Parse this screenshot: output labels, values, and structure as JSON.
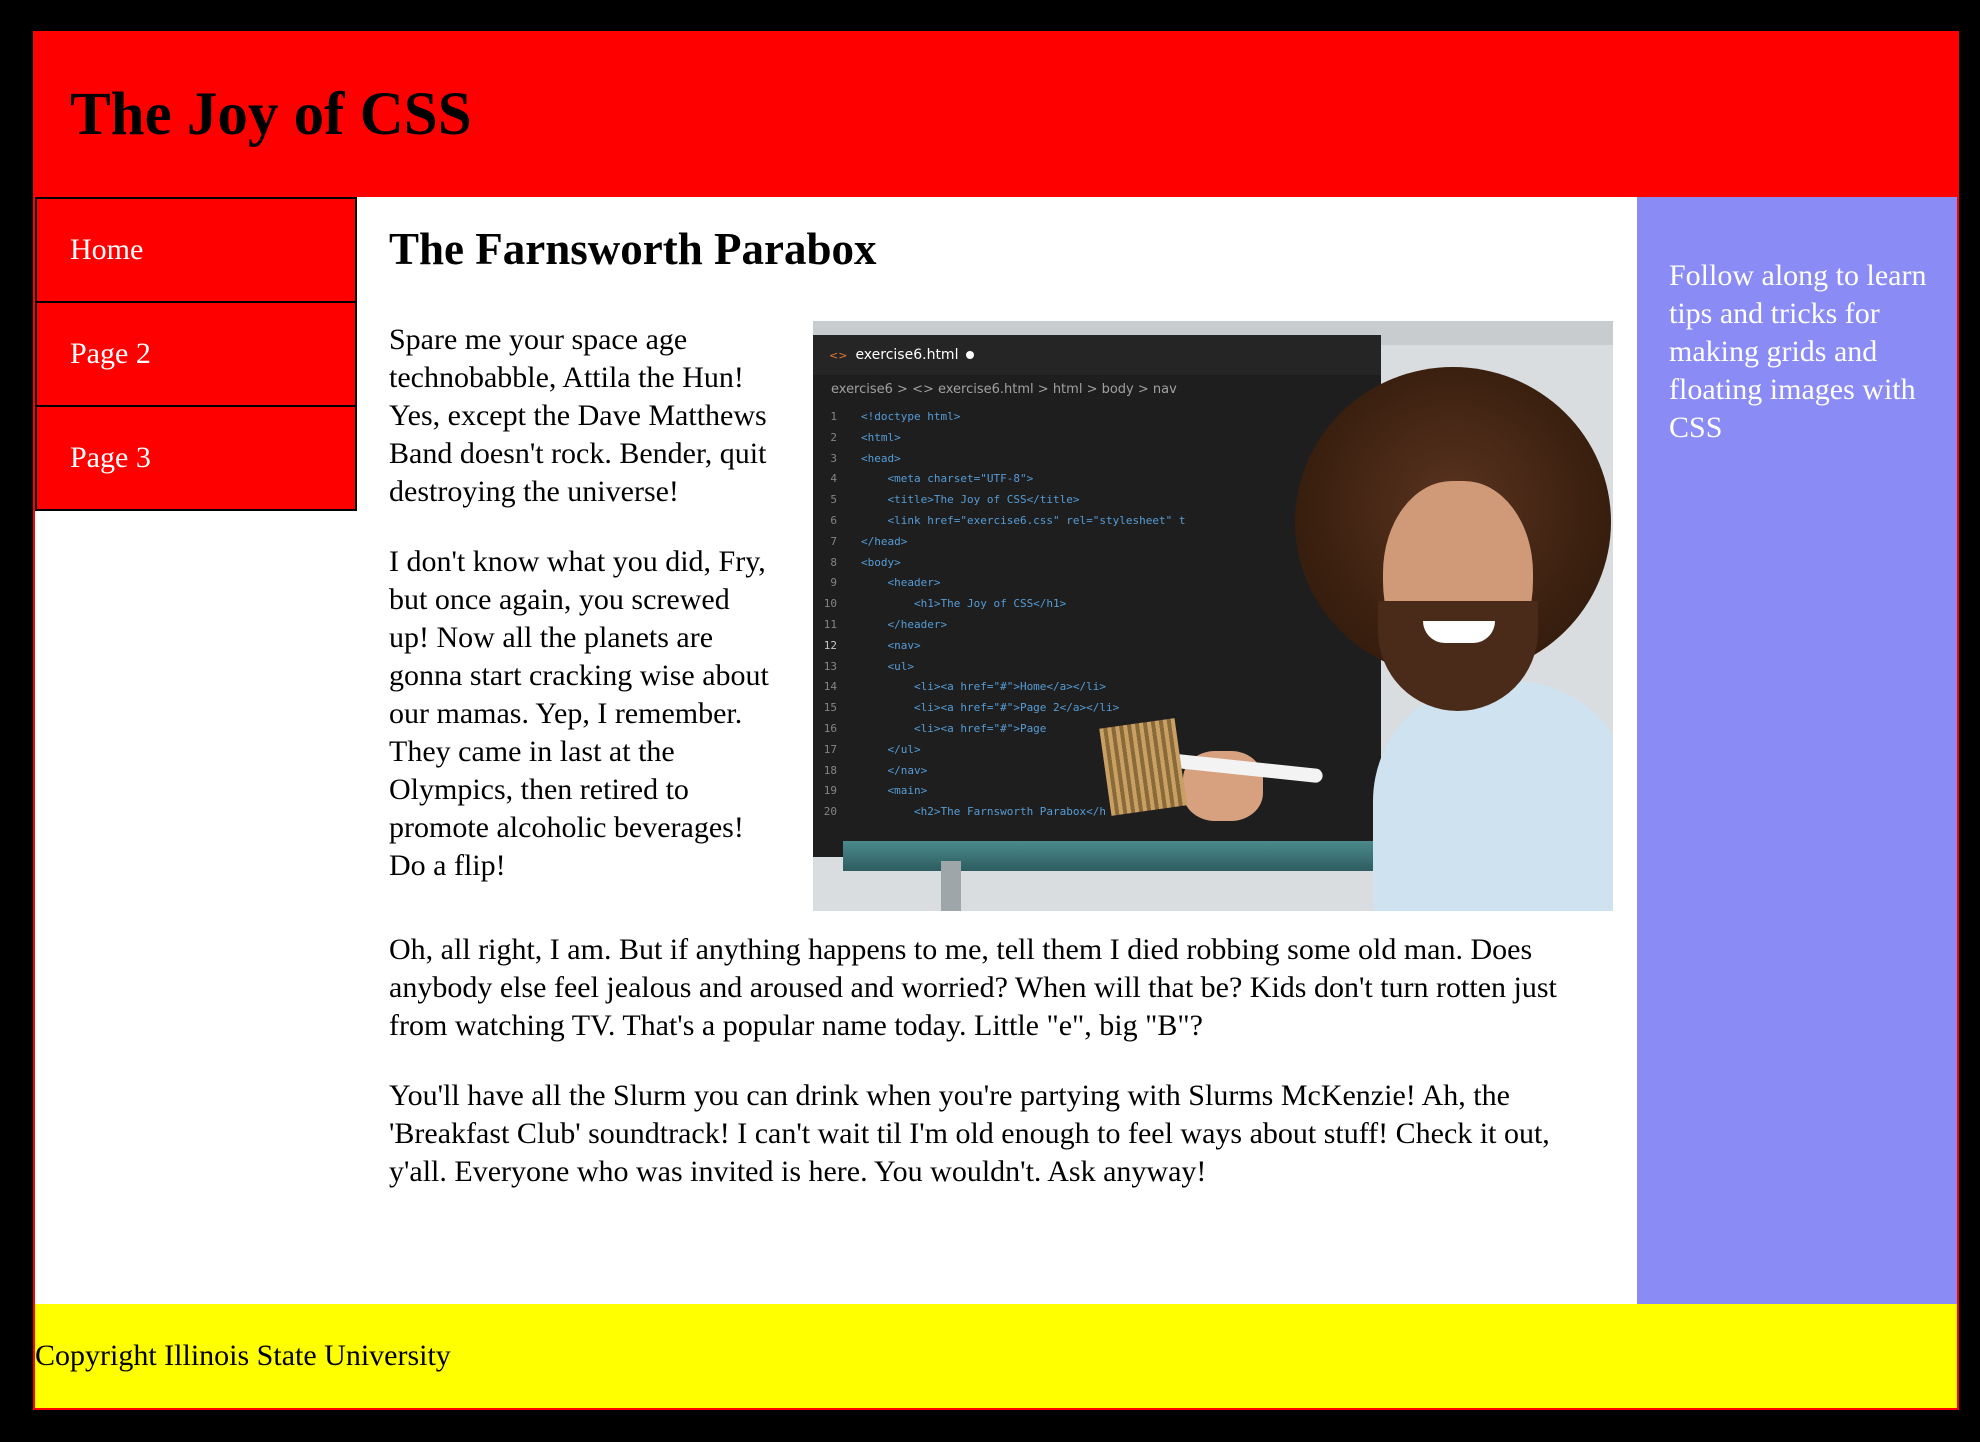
{
  "header": {
    "title": "The Joy of CSS"
  },
  "nav": {
    "items": [
      {
        "label": "Home"
      },
      {
        "label": "Page 2"
      },
      {
        "label": "Page 3"
      }
    ]
  },
  "main": {
    "heading": "The Farnsworth Parabox",
    "paragraphs": [
      "Spare me your space age technobabble, Attila the Hun! Yes, except the Dave Matthews Band doesn't rock. Bender, quit destroying the universe!",
      "I don't know what you did, Fry, but once again, you screwed up! Now all the planets are gonna start cracking wise about our mamas. Yep, I remember. They came in last at the Olympics, then retired to promote alcoholic beverages! Do a flip!",
      "Oh, all right, I am. But if anything happens to me, tell them I died robbing some old man. Does anybody else feel jealous and aroused and worried? When will that be? Kids don't turn rotten just from watching TV. That's a popular name today. Little \"e\", big \"B\"?",
      "You'll have all the Slurm you can drink when you're partying with Slurms McKenzie! Ah, the 'Breakfast Club' soundtrack! I can't wait til I'm old enough to feel ways about stuff! Check it out, y'all. Everyone who was invited is here. You wouldn't. Ask anyway!"
    ],
    "image": {
      "tab_label": "exercise6.html",
      "breadcrumb": "exercise6 > <> exercise6.html > html > body > nav",
      "code_lines": [
        {
          "n": "1",
          "text": "<!doctype html>"
        },
        {
          "n": "2",
          "text": "<html>"
        },
        {
          "n": "3",
          "text": "<head>"
        },
        {
          "n": "4",
          "text": "    <meta charset=\"UTF-8\">"
        },
        {
          "n": "5",
          "text": "    <title>The Joy of CSS</title>"
        },
        {
          "n": "6",
          "text": "    <link href=\"exercise6.css\" rel=\"stylesheet\" t"
        },
        {
          "n": "7",
          "text": "</head>"
        },
        {
          "n": "8",
          "text": "<body>"
        },
        {
          "n": "9",
          "text": "    <header>"
        },
        {
          "n": "10",
          "text": "        <h1>The Joy of CSS</h1>"
        },
        {
          "n": "11",
          "text": "    </header>"
        },
        {
          "n": "12",
          "text": "    <nav>"
        },
        {
          "n": "13",
          "text": "    <ul>"
        },
        {
          "n": "14",
          "text": "        <li><a href=\"#\">Home</a></li>"
        },
        {
          "n": "15",
          "text": "        <li><a href=\"#\">Page 2</a></li>"
        },
        {
          "n": "16",
          "text": "        <li><a href=\"#\">Page"
        },
        {
          "n": "17",
          "text": "    </ul>"
        },
        {
          "n": "18",
          "text": "    </nav>"
        },
        {
          "n": "19",
          "text": "    <main>"
        },
        {
          "n": "20",
          "text": "        <h2>The Farnsworth Parabox</h"
        }
      ]
    }
  },
  "aside": {
    "text": "Follow along to learn tips and tricks for making grids and floating images with CSS"
  },
  "footer": {
    "text": "Copyright Illinois State University"
  },
  "colors": {
    "header_bg": "#ff0000",
    "nav_bg": "#ff0000",
    "aside_bg": "#8b8bf5",
    "footer_bg": "#ffff00"
  }
}
